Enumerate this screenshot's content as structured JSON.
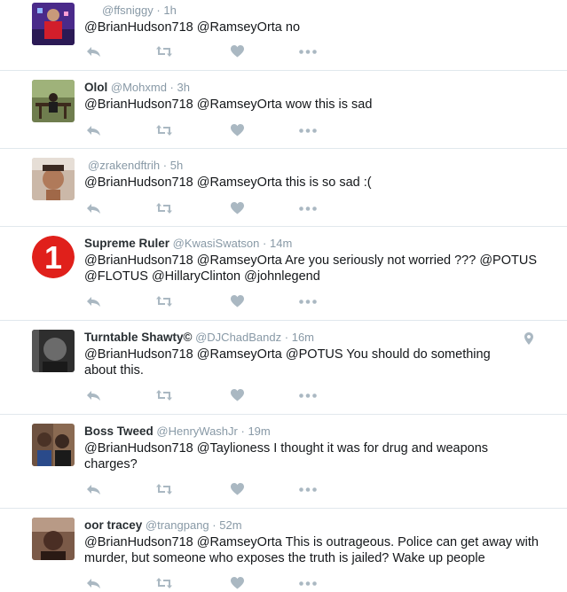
{
  "tweets": [
    {
      "name": "",
      "handle": "@ffsniggy",
      "time": "1h",
      "text": "@BrianHudson718 @RamseyOrta no"
    },
    {
      "name": "Olol",
      "handle": "@Mohxmd",
      "time": "3h",
      "text": "@BrianHudson718 @RamseyOrta wow this is sad"
    },
    {
      "name": "",
      "handle": "@zrakendftrih",
      "time": "5h",
      "text": "@BrianHudson718  @RamseyOrta this is so sad :("
    },
    {
      "name": "Supreme Ruler",
      "handle": "@KwasiSwatson",
      "time": "14m",
      "text": "@BrianHudson718 @RamseyOrta Are you seriously not worried ??? @POTUS @FLOTUS @HillaryClinton @johnlegend"
    },
    {
      "name": "Turntable Shawty©",
      "handle": "@DJChadBandz",
      "time": "16m",
      "text": "@BrianHudson718 @RamseyOrta @POTUS  You should do something about this."
    },
    {
      "name": "Boss Tweed",
      "handle": "@HenryWashJr",
      "time": "19m",
      "text": "@BrianHudson718 @Taylioness I thought it was for drug and weapons charges?"
    },
    {
      "name": "oor tracey",
      "handle": "@trangpang",
      "time": "52m",
      "text": "@BrianHudson718 @RamseyOrta This is outrageous. Police can get away with murder, but someone who exposes the truth is jailed? Wake up people"
    }
  ],
  "separator": "·",
  "avatar_badge_text": "1",
  "icons": {
    "reply": "reply-icon",
    "retweet": "retweet-icon",
    "like": "heart-icon",
    "more": "more-dots-icon",
    "geo": "location-pin-icon"
  },
  "colors": {
    "action_icon": "#aab8c2",
    "handle": "#8899a6",
    "badge_red": "#e0201b",
    "divider": "#e1e8ed"
  }
}
